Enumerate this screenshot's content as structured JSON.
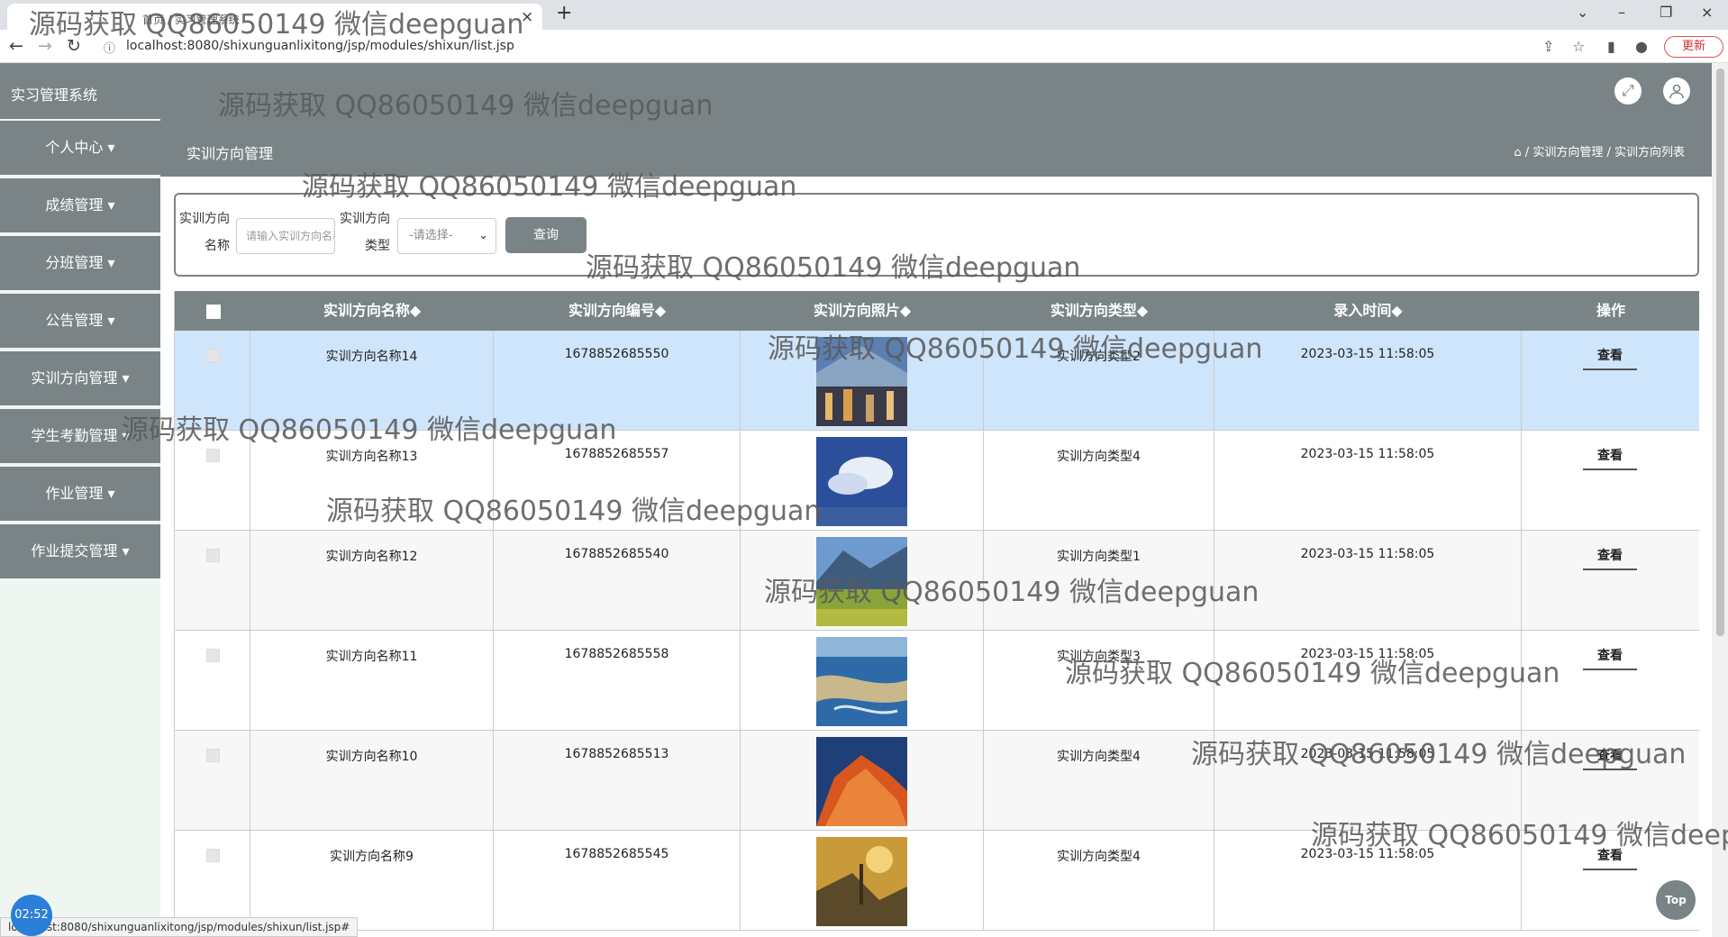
{
  "browser": {
    "tab_title": "首页 / 实习管理系统",
    "url": "localhost:8080/shixunguanlixitong/jsp/modules/shixun/list.jsp",
    "update_label": "更新",
    "status_url": "localhost:8080/shixunguanlixitong/jsp/modules/shixun/list.jsp#"
  },
  "header": {
    "app_title": "实习管理系统"
  },
  "sidebar": {
    "items": [
      {
        "label": "个人中心"
      },
      {
        "label": "成绩管理"
      },
      {
        "label": "分班管理"
      },
      {
        "label": "公告管理"
      },
      {
        "label": "实训方向管理"
      },
      {
        "label": "学生考勤管理"
      },
      {
        "label": "作业管理"
      },
      {
        "label": "作业提交管理"
      }
    ]
  },
  "page": {
    "title": "实训方向管理",
    "breadcrumb_1": "实训方向管理",
    "breadcrumb_2": "实训方向列表"
  },
  "search": {
    "name_label_1": "实训方向",
    "name_label_2": "名称",
    "name_placeholder": "请输入实训方向名称",
    "type_label_1": "实训方向",
    "type_label_2": "类型",
    "type_selected": "-请选择-",
    "button_label": "查询"
  },
  "table": {
    "columns": [
      "实训方向名称◆",
      "实训方向编号◆",
      "实训方向照片◆",
      "实训方向类型◆",
      "录入时间◆",
      "操作"
    ],
    "rows": [
      {
        "name": "实训方向名称14",
        "code": "1678852685550",
        "type": "实训方向类型2",
        "time": "2023-03-15 11:58:05",
        "action": "查看"
      },
      {
        "name": "实训方向名称13",
        "code": "1678852685557",
        "type": "实训方向类型4",
        "time": "2023-03-15 11:58:05",
        "action": "查看"
      },
      {
        "name": "实训方向名称12",
        "code": "1678852685540",
        "type": "实训方向类型1",
        "time": "2023-03-15 11:58:05",
        "action": "查看"
      },
      {
        "name": "实训方向名称11",
        "code": "1678852685558",
        "type": "实训方向类型3",
        "time": "2023-03-15 11:58:05",
        "action": "查看"
      },
      {
        "name": "实训方向名称10",
        "code": "1678852685513",
        "type": "实训方向类型4",
        "time": "2023-03-15 11:58:05",
        "action": "查看"
      },
      {
        "name": "实训方向名称9",
        "code": "1678852685545",
        "type": "实训方向类型4",
        "time": "2023-03-15 11:58:05",
        "action": "查看"
      }
    ]
  },
  "misc": {
    "timer": "02:52",
    "top_label": "Top",
    "watermark": "源码获取 QQ86050149 微信deepguan"
  }
}
